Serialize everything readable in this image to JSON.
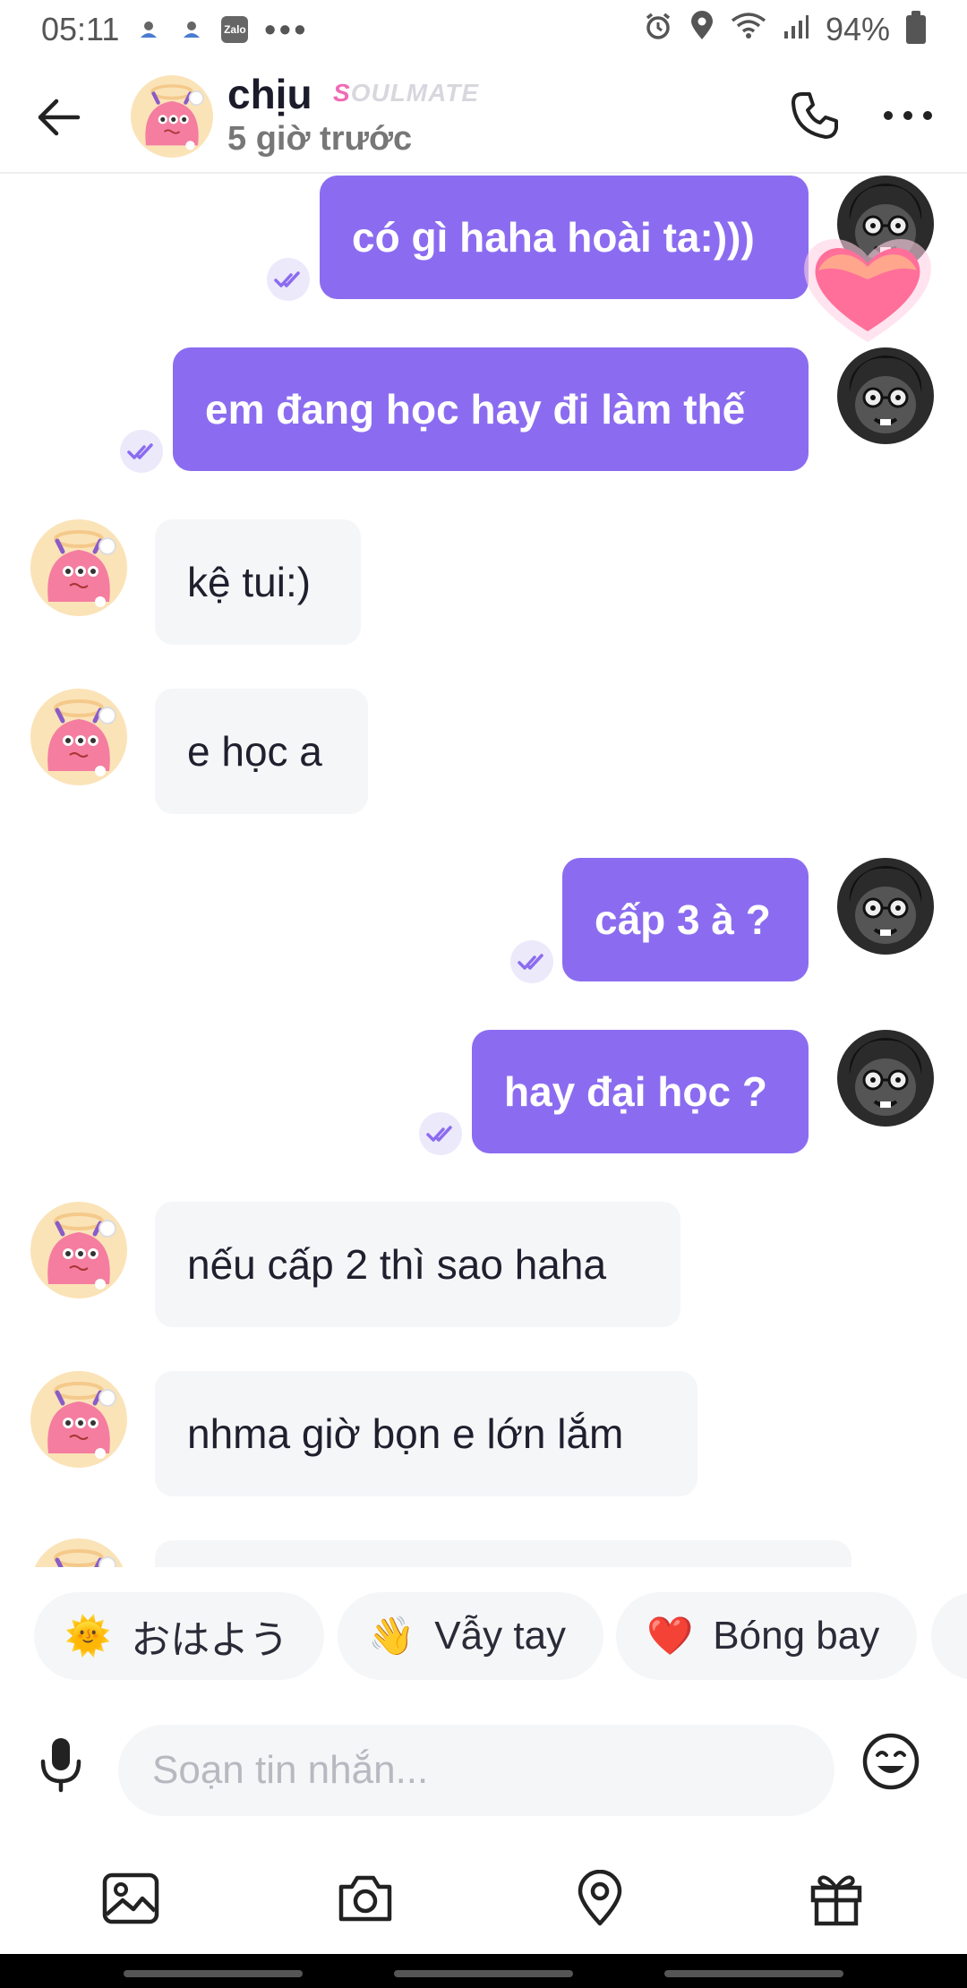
{
  "status_bar": {
    "time": "05:11",
    "zalo_label": "Zalo",
    "more": "•••",
    "battery": "94%"
  },
  "header": {
    "name": "chịu",
    "badge_first": "S",
    "badge_rest": "OULMATE",
    "last_seen": "5 giờ trước"
  },
  "messages": [
    {
      "direction": "out",
      "text": "có gì haha hoài ta:)))"
    },
    {
      "direction": "out",
      "text": "em đang học hay đi làm thế"
    },
    {
      "direction": "in",
      "text": "kệ tui:)"
    },
    {
      "direction": "in",
      "text": "e học a"
    },
    {
      "direction": "out",
      "text": "cấp 3 à ?"
    },
    {
      "direction": "out",
      "text": "hay đại học ?"
    },
    {
      "direction": "in",
      "text": "nếu cấp 2 thì sao haha"
    },
    {
      "direction": "in",
      "text": "nhma giờ bọn e lớn lắm"
    }
  ],
  "quick_replies": [
    {
      "emoji": "🌞",
      "label": "おはよう"
    },
    {
      "emoji": "👋",
      "label": "Vẫy tay"
    },
    {
      "emoji": "❤️",
      "label": "Bóng bay"
    }
  ],
  "composer": {
    "placeholder": "Soạn tin nhắn..."
  },
  "colors": {
    "accent": "#8b6cf0",
    "incoming_bubble": "#f5f6f8",
    "badge_pink": "#f06bb5"
  },
  "icons": {
    "back": "arrow-left-icon",
    "call": "phone-icon",
    "more": "more-horizontal-icon",
    "mic": "microphone-icon",
    "emoji": "smiley-icon",
    "gallery": "image-icon",
    "camera": "camera-icon",
    "location": "location-pin-icon",
    "gift": "gift-icon"
  }
}
